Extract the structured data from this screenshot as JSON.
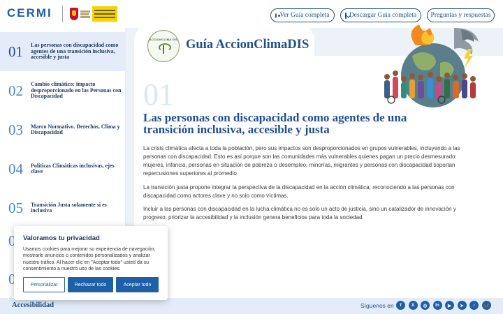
{
  "header": {
    "logo_text": "CERMI",
    "btn_view": "Ver Guía completa",
    "btn_download": "Descargar Guía completa",
    "btn_faq": "Preguntas y respuestas"
  },
  "sidebar": {
    "items": [
      {
        "num": "01",
        "label": "Las personas con discapacidad como agentes de una transición inclusiva, accesible y justa"
      },
      {
        "num": "02",
        "label": "Cambio climático: impacto desproporcionado en las Personas con Discapacidad"
      },
      {
        "num": "03",
        "label": "Marco Normativo. Derechos, Clima y Discapacidad"
      },
      {
        "num": "04",
        "label": "Políticas Climáticas inclusivas, ejes clave"
      },
      {
        "num": "05",
        "label": "Transición Justa solamente si es inclusiva"
      },
      {
        "num": "06",
        "label": ""
      },
      {
        "num": "07",
        "label": ""
      }
    ]
  },
  "main": {
    "badge_text": "ACCIONCLIMA DIS",
    "guide_title": "Guía AccionClimaDIS",
    "section_number": "01",
    "section_title": "Las personas con discapacidad como agentes de una transición inclusiva, accesible y justa",
    "paragraphs": [
      "La crisis climática afecta a toda la población, pero sus impactos son desproporcionados en grupos vulnerables, incluyendo a las personas con discapacidad. Esto es así porque son las comunidades más vulnerables quienes pagan un precio desmesurado: mujeres, infancia, personas en situación de pobreza o desempleo, minorías, migrantes y personas con discapacidad soportan repercusiones superiores al promedio.",
      "La transición justa propone integrar la perspectiva de la discapacidad en la acción climática, reconociendo a las personas con discapacidad como actores clave y no solo como víctimas.",
      "Incluir a las personas con discapacidad en la lucha climática no es solo un acto de justicia, sino un catalizador de innovación y progreso: priorizar la accesibilidad y la inclusión genera beneficios para toda la sociedad."
    ]
  },
  "cookie": {
    "title": "Valoramos tu privacidad",
    "text": "Usamos cookies para mejorar su experiencia de navegación, mostrarle anuncios o contenidos personalizados y analizar nuestro tráfico. Al hacer clic en \"Aceptar todo\" usted da su consentimiento a nuestro uso de las cookies.",
    "btn_personalize": "Personalizar",
    "btn_reject": "Rechazar todo",
    "btn_accept": "Aceptar todo"
  },
  "footer": {
    "accessibility": "Accesibilidad",
    "follow": "Síguenos en",
    "socials": [
      {
        "name": "facebook-icon",
        "glyph": "f"
      },
      {
        "name": "x-icon",
        "glyph": "X"
      },
      {
        "name": "instagram-icon",
        "glyph": "◎"
      },
      {
        "name": "linkedin-icon",
        "glyph": "in"
      },
      {
        "name": "youtube-icon",
        "glyph": "▶"
      },
      {
        "name": "telegram-icon",
        "glyph": "➤"
      },
      {
        "name": "tiktok-icon",
        "glyph": "♪"
      },
      {
        "name": "bluesky-icon",
        "glyph": "🦋"
      }
    ]
  },
  "colors": {
    "brand_blue": "#1f4f8f",
    "accent_blue": "#1f5fa8",
    "active_bg": "#e3ecf8"
  }
}
